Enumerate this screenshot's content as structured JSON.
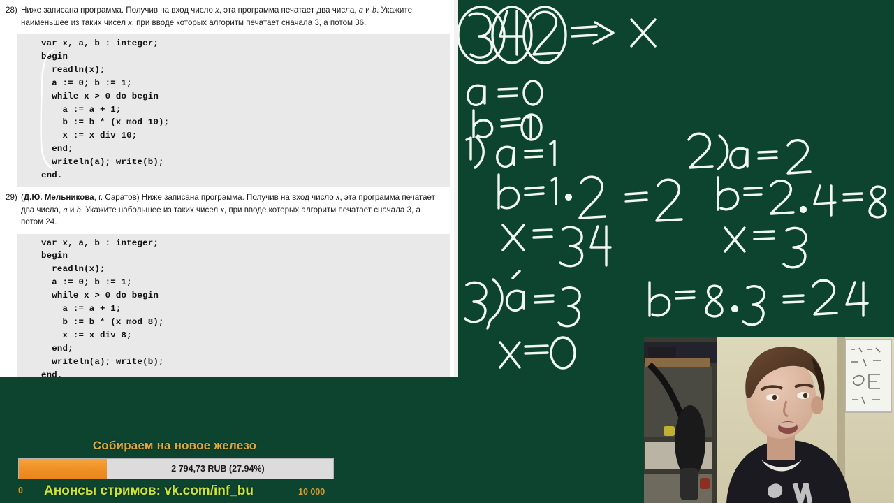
{
  "document": {
    "problems": [
      {
        "number": "28)",
        "statement_parts": [
          "Ниже записана программа. Получив на вход число ",
          "x",
          ", эта программа печатает два числа, ",
          "a",
          " и ",
          "b",
          ". Укажите наименьшее из таких чисел ",
          "x",
          ", при вводе которых алгоритм печатает сначала 3, а потом 36."
        ],
        "author": "",
        "code": "var x, a, b : integer;\nbegin\n  readln(x);\n  a := 0; b := 1;\n  while x > 0 do begin\n    a := a + 1;\n    b := b * (x mod 10);\n    x := x div 10;\n  end;\n  writeln(a); write(b);\nend."
      },
      {
        "number": "29)",
        "author_bold": "Д.Ю. Мельникова",
        "author_rest": ", г. Саратов",
        "statement_parts": [
          "(",
          "Д.Ю. Мельникова",
          ", г. Саратов) Ниже записана программа. Получив на вход число ",
          "x",
          ", эта программа печатает два числа, ",
          "a",
          " и ",
          "b",
          ". Укажите набольшее из таких чисел ",
          "x",
          ", при вводе которых алгоритм печатает сначала 3, а потом 24."
        ],
        "code": "var x, a, b : integer;\nbegin\n  readln(x);\n  a := 0; b := 1;\n  while x > 0 do begin\n    a := a + 1;\n    b := b * (x mod 8);\n    x := x div 8;\n  end;\n  writeln(a); write(b);\nend."
      }
    ]
  },
  "board": {
    "background_color": "#0c4430",
    "ink_color": "#f2f7f0",
    "lines": {
      "input_digits": "342",
      "input_arrow": "=>",
      "input_var": "x",
      "init_a": "a = 0",
      "init_b": "b = 1",
      "step1_label": "1)",
      "step1_a": "a = 1",
      "step1_b": "b = 1 · 2 = 2",
      "step1_x": "x = 34",
      "step2_label": "2)",
      "step2_a": "a = 2",
      "step2_b": "b = 2 · 4 = 8",
      "step2_x": "x = 3",
      "step3_label": "3)",
      "step3_a": "a = 3",
      "step3_b": "b = 8 · 3 = 24",
      "step3_x": "x = 0"
    }
  },
  "donation": {
    "title": "Собираем на новое железо",
    "amount_label": "2 794,73 RUB (27.94%)",
    "percent": 27.94,
    "scale_min": "0",
    "scale_max": "10 000",
    "announce": "Анонсы стримов: vk.com/inf_bu",
    "bar_fill_color": "#ef8f24",
    "title_color": "#e0a83a",
    "announce_color": "#cfe23a"
  },
  "webcam": {
    "label": "webcam-feed"
  }
}
